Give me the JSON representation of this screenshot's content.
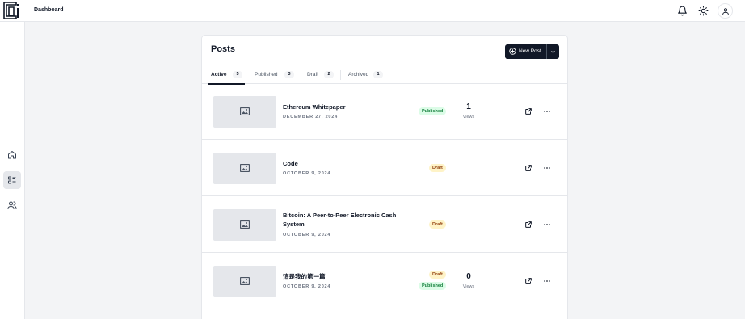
{
  "header": {
    "breadcrumb": "Dashboard",
    "icons": [
      "logo-icon",
      "bell-icon",
      "sun-icon",
      "user-icon"
    ]
  },
  "sidebar": {
    "items": [
      {
        "icon": "home-icon",
        "active": false
      },
      {
        "icon": "list-icon",
        "active": true
      },
      {
        "icon": "users-icon",
        "active": false
      }
    ]
  },
  "posts": {
    "title": "Posts",
    "new_post_label": "New Post",
    "tabs": [
      {
        "label": "Active",
        "count": "5"
      },
      {
        "label": "Published",
        "count": "3"
      },
      {
        "label": "Draft",
        "count": "2"
      },
      {
        "label": "Archived",
        "count": "1"
      }
    ],
    "items": [
      {
        "title": "Ethereum Whitepaper",
        "date": "DECEMBER 27, 2024",
        "badges": [
          "Published"
        ],
        "views": "1",
        "views_label": "Views"
      },
      {
        "title": "Code",
        "date": "OCTOBER 9, 2024",
        "badges": [
          "Draft"
        ]
      },
      {
        "title": "Bitcoin: A Peer-to-Peer Electronic Cash System",
        "date": "OCTOBER 9, 2024",
        "badges": [
          "Draft"
        ]
      },
      {
        "title": "這是我的第一篇",
        "date": "OCTOBER 9, 2024",
        "badges": [
          "Draft",
          "Published"
        ],
        "views": "0",
        "views_label": "Views"
      }
    ]
  },
  "colors": {
    "primary": "#111827",
    "published_bg": "#dcfce7",
    "published_text": "#15803d",
    "draft_bg": "#fef3c7",
    "draft_text": "#92400e",
    "page_bg": "#f3f4f6"
  }
}
